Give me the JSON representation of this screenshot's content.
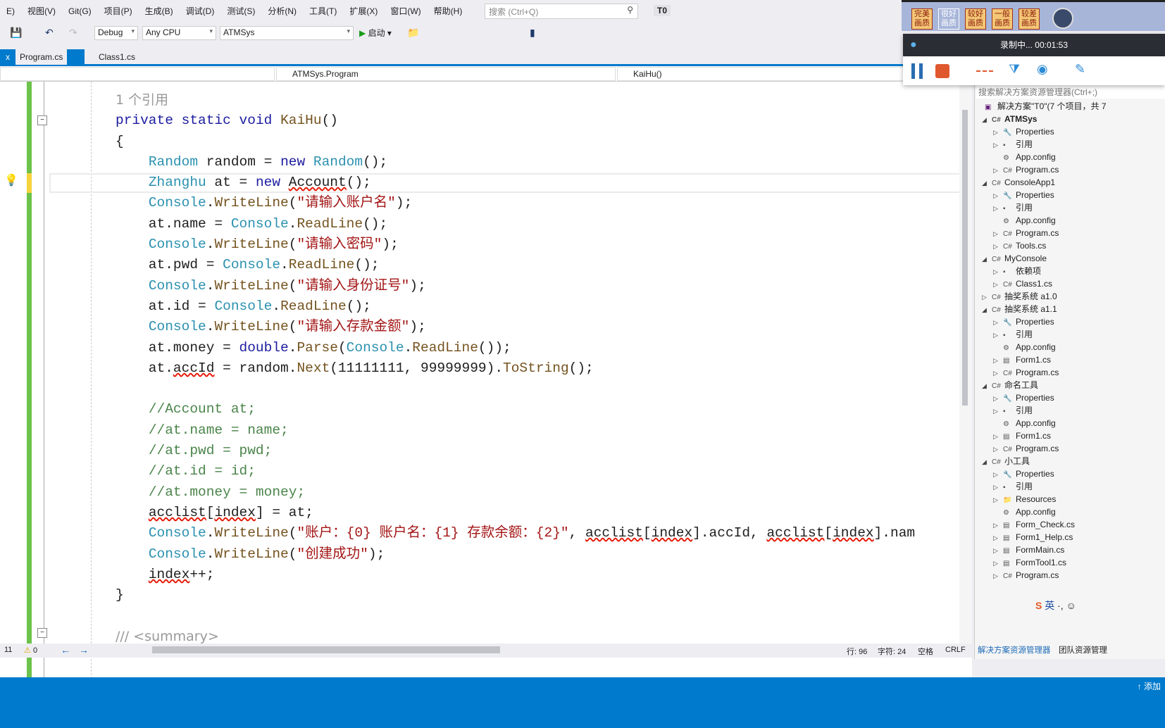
{
  "menu": [
    "E)",
    "视图(V)",
    "Git(G)",
    "项目(P)",
    "生成(B)",
    "调试(D)",
    "测试(S)",
    "分析(N)",
    "工具(T)",
    "扩展(X)",
    "窗口(W)",
    "帮助(H)"
  ],
  "search": {
    "placeholder": "搜索 (Ctrl+Q)",
    "icon": "search-icon"
  },
  "solution_name": "T0",
  "toolbar": {
    "config": "Debug",
    "platform": "Any CPU",
    "startup": "ATMSys",
    "start_label": "启动"
  },
  "tabs": [
    {
      "label": "Program.cs",
      "active": true,
      "close": "x"
    },
    {
      "label": "Class1.cs"
    }
  ],
  "nav": {
    "type": "ATMSys.Program",
    "member": "KaiHu()"
  },
  "code_lines": [
    [
      [
        "rf",
        "1 个引用"
      ]
    ],
    [
      [
        "kw",
        "private"
      ],
      [
        "pl",
        " "
      ],
      [
        "kw",
        "static"
      ],
      [
        "pl",
        " "
      ],
      [
        "kw",
        "void"
      ],
      [
        "pl",
        " "
      ],
      [
        "me",
        "KaiHu"
      ],
      [
        "pl",
        "()"
      ]
    ],
    [
      [
        "pl",
        "{"
      ]
    ],
    [
      [
        "pl",
        "    "
      ],
      [
        "ty",
        "Random"
      ],
      [
        "pl",
        " random = "
      ],
      [
        "kw",
        "new"
      ],
      [
        "pl",
        " "
      ],
      [
        "ty",
        "Random"
      ],
      [
        "pl",
        "();"
      ]
    ],
    [
      [
        "pl",
        "    "
      ],
      [
        "ty",
        "Zhanghu"
      ],
      [
        "pl",
        " at = "
      ],
      [
        "kw",
        "new"
      ],
      [
        "pl",
        " "
      ],
      [
        "sq",
        "Account"
      ],
      [
        "pl",
        "();"
      ]
    ],
    [
      [
        "pl",
        "    "
      ],
      [
        "ty",
        "Console"
      ],
      [
        "pl",
        "."
      ],
      [
        "me",
        "WriteLine"
      ],
      [
        "pl",
        "("
      ],
      [
        "st",
        "\"请输入账户名\""
      ],
      [
        "pl",
        ");"
      ]
    ],
    [
      [
        "pl",
        "    at.name = "
      ],
      [
        "ty",
        "Console"
      ],
      [
        "pl",
        "."
      ],
      [
        "me",
        "ReadLine"
      ],
      [
        "pl",
        "();"
      ]
    ],
    [
      [
        "pl",
        "    "
      ],
      [
        "ty",
        "Console"
      ],
      [
        "pl",
        "."
      ],
      [
        "me",
        "WriteLine"
      ],
      [
        "pl",
        "("
      ],
      [
        "st",
        "\"请输入密码\""
      ],
      [
        "pl",
        ");"
      ]
    ],
    [
      [
        "pl",
        "    at.pwd = "
      ],
      [
        "ty",
        "Console"
      ],
      [
        "pl",
        "."
      ],
      [
        "me",
        "ReadLine"
      ],
      [
        "pl",
        "();"
      ]
    ],
    [
      [
        "pl",
        "    "
      ],
      [
        "ty",
        "Console"
      ],
      [
        "pl",
        "."
      ],
      [
        "me",
        "WriteLine"
      ],
      [
        "pl",
        "("
      ],
      [
        "st",
        "\"请输入身份证号\""
      ],
      [
        "pl",
        ");"
      ]
    ],
    [
      [
        "pl",
        "    at.id = "
      ],
      [
        "ty",
        "Console"
      ],
      [
        "pl",
        "."
      ],
      [
        "me",
        "ReadLine"
      ],
      [
        "pl",
        "();"
      ]
    ],
    [
      [
        "pl",
        "    "
      ],
      [
        "ty",
        "Console"
      ],
      [
        "pl",
        "."
      ],
      [
        "me",
        "WriteLine"
      ],
      [
        "pl",
        "("
      ],
      [
        "st",
        "\"请输入存款金额\""
      ],
      [
        "pl",
        ");"
      ]
    ],
    [
      [
        "pl",
        "    at.money = "
      ],
      [
        "kw",
        "double"
      ],
      [
        "pl",
        "."
      ],
      [
        "me",
        "Parse"
      ],
      [
        "pl",
        "("
      ],
      [
        "ty",
        "Console"
      ],
      [
        "pl",
        "."
      ],
      [
        "me",
        "ReadLine"
      ],
      [
        "pl",
        "());"
      ]
    ],
    [
      [
        "pl",
        "    at."
      ],
      [
        "sq",
        "accId"
      ],
      [
        "pl",
        " = random."
      ],
      [
        "me",
        "Next"
      ],
      [
        "pl",
        "(11111111, 99999999)."
      ],
      [
        "me",
        "ToString"
      ],
      [
        "pl",
        "();"
      ]
    ],
    [
      [
        "pl",
        ""
      ]
    ],
    [
      [
        "pl",
        "    "
      ],
      [
        "cm",
        "//Account at;"
      ]
    ],
    [
      [
        "pl",
        "    "
      ],
      [
        "cm",
        "//at.name = name;"
      ]
    ],
    [
      [
        "pl",
        "    "
      ],
      [
        "cm",
        "//at.pwd = pwd;"
      ]
    ],
    [
      [
        "pl",
        "    "
      ],
      [
        "cm",
        "//at.id = id;"
      ]
    ],
    [
      [
        "pl",
        "    "
      ],
      [
        "cm",
        "//at.money = money;"
      ]
    ],
    [
      [
        "pl",
        "    "
      ],
      [
        "sq",
        "acclist"
      ],
      [
        "pl",
        "["
      ],
      [
        "sq",
        "index"
      ],
      [
        "pl",
        "] = at;"
      ]
    ],
    [
      [
        "pl",
        "    "
      ],
      [
        "ty",
        "Console"
      ],
      [
        "pl",
        "."
      ],
      [
        "me",
        "WriteLine"
      ],
      [
        "pl",
        "("
      ],
      [
        "st",
        "\"账户：{0} 账户名：{1} 存款余额：{2}\""
      ],
      [
        "pl",
        ", "
      ],
      [
        "sq",
        "acclist"
      ],
      [
        "pl",
        "["
      ],
      [
        "sq",
        "index"
      ],
      [
        "pl",
        "].accId, "
      ],
      [
        "sq",
        "acclist"
      ],
      [
        "pl",
        "["
      ],
      [
        "sq",
        "index"
      ],
      [
        "pl",
        "].nam"
      ]
    ],
    [
      [
        "pl",
        "    "
      ],
      [
        "ty",
        "Console"
      ],
      [
        "pl",
        "."
      ],
      [
        "me",
        "WriteLine"
      ],
      [
        "pl",
        "("
      ],
      [
        "st",
        "\"创建成功\""
      ],
      [
        "pl",
        ");"
      ]
    ],
    [
      [
        "pl",
        "    "
      ],
      [
        "sq",
        "index"
      ],
      [
        "pl",
        "++;"
      ]
    ],
    [
      [
        "pl",
        "}"
      ]
    ],
    [
      [
        "pl",
        ""
      ]
    ],
    [
      [
        "rf",
        "/// <summary>"
      ]
    ]
  ],
  "status": {
    "errors": "11",
    "warnings": "0",
    "line": "行: 96",
    "col": "字符: 24",
    "space": "空格",
    "eol": "CRLF"
  },
  "solution_explorer": {
    "search_placeholder": "搜索解决方案资源管理器(Ctrl+;)",
    "root": "解决方案\"T0\"(7 个项目，共 7",
    "items": [
      {
        "d": 0,
        "ar": "◢",
        "ic": "C#",
        "t": "ATMSys",
        "b": true
      },
      {
        "d": 1,
        "ar": "▷",
        "ic": "🔧",
        "t": "Properties"
      },
      {
        "d": 1,
        "ar": "▷",
        "ic": "▪",
        "t": "引用"
      },
      {
        "d": 1,
        "ar": "",
        "ic": "⚙",
        "t": "App.config"
      },
      {
        "d": 1,
        "ar": "▷",
        "ic": "C#",
        "t": "Program.cs"
      },
      {
        "d": 0,
        "ar": "◢",
        "ic": "C#",
        "t": "ConsoleApp1"
      },
      {
        "d": 1,
        "ar": "▷",
        "ic": "🔧",
        "t": "Properties"
      },
      {
        "d": 1,
        "ar": "▷",
        "ic": "▪",
        "t": "引用"
      },
      {
        "d": 1,
        "ar": "",
        "ic": "⚙",
        "t": "App.config"
      },
      {
        "d": 1,
        "ar": "▷",
        "ic": "C#",
        "t": "Program.cs"
      },
      {
        "d": 1,
        "ar": "▷",
        "ic": "C#",
        "t": "Tools.cs"
      },
      {
        "d": 0,
        "ar": "◢",
        "ic": "C#",
        "t": "MyConsole"
      },
      {
        "d": 1,
        "ar": "▷",
        "ic": "▪",
        "t": "依赖项"
      },
      {
        "d": 1,
        "ar": "▷",
        "ic": "C#",
        "t": "Class1.cs"
      },
      {
        "d": 0,
        "ar": "▷",
        "ic": "C#",
        "t": "抽奖系统 a1.0"
      },
      {
        "d": 0,
        "ar": "◢",
        "ic": "C#",
        "t": "抽奖系统 a1.1"
      },
      {
        "d": 1,
        "ar": "▷",
        "ic": "🔧",
        "t": "Properties"
      },
      {
        "d": 1,
        "ar": "▷",
        "ic": "▪",
        "t": "引用"
      },
      {
        "d": 1,
        "ar": "",
        "ic": "⚙",
        "t": "App.config"
      },
      {
        "d": 1,
        "ar": "▷",
        "ic": "▤",
        "t": "Form1.cs"
      },
      {
        "d": 1,
        "ar": "▷",
        "ic": "C#",
        "t": "Program.cs"
      },
      {
        "d": 0,
        "ar": "◢",
        "ic": "C#",
        "t": "命名工具"
      },
      {
        "d": 1,
        "ar": "▷",
        "ic": "🔧",
        "t": "Properties"
      },
      {
        "d": 1,
        "ar": "▷",
        "ic": "▪",
        "t": "引用"
      },
      {
        "d": 1,
        "ar": "",
        "ic": "⚙",
        "t": "App.config"
      },
      {
        "d": 1,
        "ar": "▷",
        "ic": "▤",
        "t": "Form1.cs"
      },
      {
        "d": 1,
        "ar": "▷",
        "ic": "C#",
        "t": "Program.cs"
      },
      {
        "d": 0,
        "ar": "◢",
        "ic": "C#",
        "t": "小工具"
      },
      {
        "d": 1,
        "ar": "▷",
        "ic": "🔧",
        "t": "Properties"
      },
      {
        "d": 1,
        "ar": "▷",
        "ic": "▪",
        "t": "引用"
      },
      {
        "d": 1,
        "ar": "▷",
        "ic": "📁",
        "t": "Resources"
      },
      {
        "d": 1,
        "ar": "",
        "ic": "⚙",
        "t": "App.config"
      },
      {
        "d": 1,
        "ar": "▷",
        "ic": "▤",
        "t": "Form_Check.cs"
      },
      {
        "d": 1,
        "ar": "▷",
        "ic": "▤",
        "t": "Form1_Help.cs"
      },
      {
        "d": 1,
        "ar": "▷",
        "ic": "▤",
        "t": "FormMain.cs"
      },
      {
        "d": 1,
        "ar": "▷",
        "ic": "▤",
        "t": "FormTool1.cs"
      },
      {
        "d": 1,
        "ar": "▷",
        "ic": "C#",
        "t": "Program.cs"
      }
    ],
    "tabs": [
      "解决方案资源管理器",
      "团队资源管理"
    ]
  },
  "recorder": {
    "quality": [
      "完美画质",
      "很好画质",
      "较好画质",
      "一般画质",
      "较差画质"
    ],
    "status": "录制中... 00:01:53"
  },
  "ime": {
    "lang": "英",
    "punct": "·,"
  },
  "bottom": {
    "right": "↑ 添加"
  }
}
